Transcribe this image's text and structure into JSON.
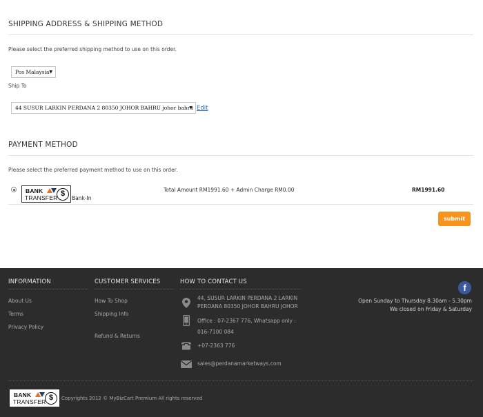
{
  "shipping": {
    "title": "SHIPPING ADDRESS & SHIPPING METHOD",
    "note": "Please select the preferred shipping method to use on this order.",
    "method_value": "Pos Malaysia",
    "ship_to_label": "Ship To",
    "address_value": "44 SUSUR LARKIN PERDANA 2 80350 JOHOR BAHRU johor bahru",
    "edit_label": "Edit"
  },
  "payment": {
    "title": "PAYMENT METHOD",
    "note": "Please select the preferred payment method to use on this order.",
    "logo_line1": "BANK",
    "logo_line2": "TRANSFER",
    "logo_symbol": "$",
    "method_label": "Bank-In",
    "total_text": "Total Amount RM1991.60 + Admin Charge RM0.00",
    "amount": "RM1991.60",
    "submit_label": "submit"
  },
  "footer": {
    "information": {
      "heading": "INFORMATION",
      "links": [
        "About Us",
        "Terms",
        "Privacy Policy"
      ]
    },
    "customer_services": {
      "heading": "CUSTOMER SERVICES",
      "links": [
        "How To Shop",
        "Shipping Info",
        "Refund & Returns"
      ]
    },
    "contact": {
      "heading": "HOW TO CONTACT US",
      "address_line1": "44, SUSUR LARKIN PERDANA 2 LARKIN",
      "address_line2": "PERDANA 80350 JOHOR BAHRU JOHOR",
      "office_line1": "Office : 07-2367 776, Whatsapp only :",
      "office_line2": "016-7100 084",
      "fax": "+07-2363 776",
      "email": "sales@perdanamarketways.com"
    },
    "facebook_symbol": "f",
    "hours_line1": "Open Sunday to Thursday 8.30am - 5.30pm",
    "hours_line2": "We closed on Friday & Saturday",
    "copyright": "Copyrights 2012 © MyBizCart Premium All rights reserved",
    "logo_line1": "BANK",
    "logo_line2": "TRANSFER",
    "logo_symbol": "$"
  },
  "colors": {
    "accent": "#f7941d",
    "link": "#2a6ebb",
    "footer_bg": "#2c2c2c",
    "facebook": "#3b5998",
    "logo_orange": "#e8712a",
    "logo_navy": "#1f3a7a"
  },
  "icons": [
    "location-pin-icon",
    "mobile-phone-icon",
    "fax-phone-icon",
    "envelope-icon",
    "facebook-icon",
    "dollar-coin-icon",
    "select-arrow-icon"
  ]
}
